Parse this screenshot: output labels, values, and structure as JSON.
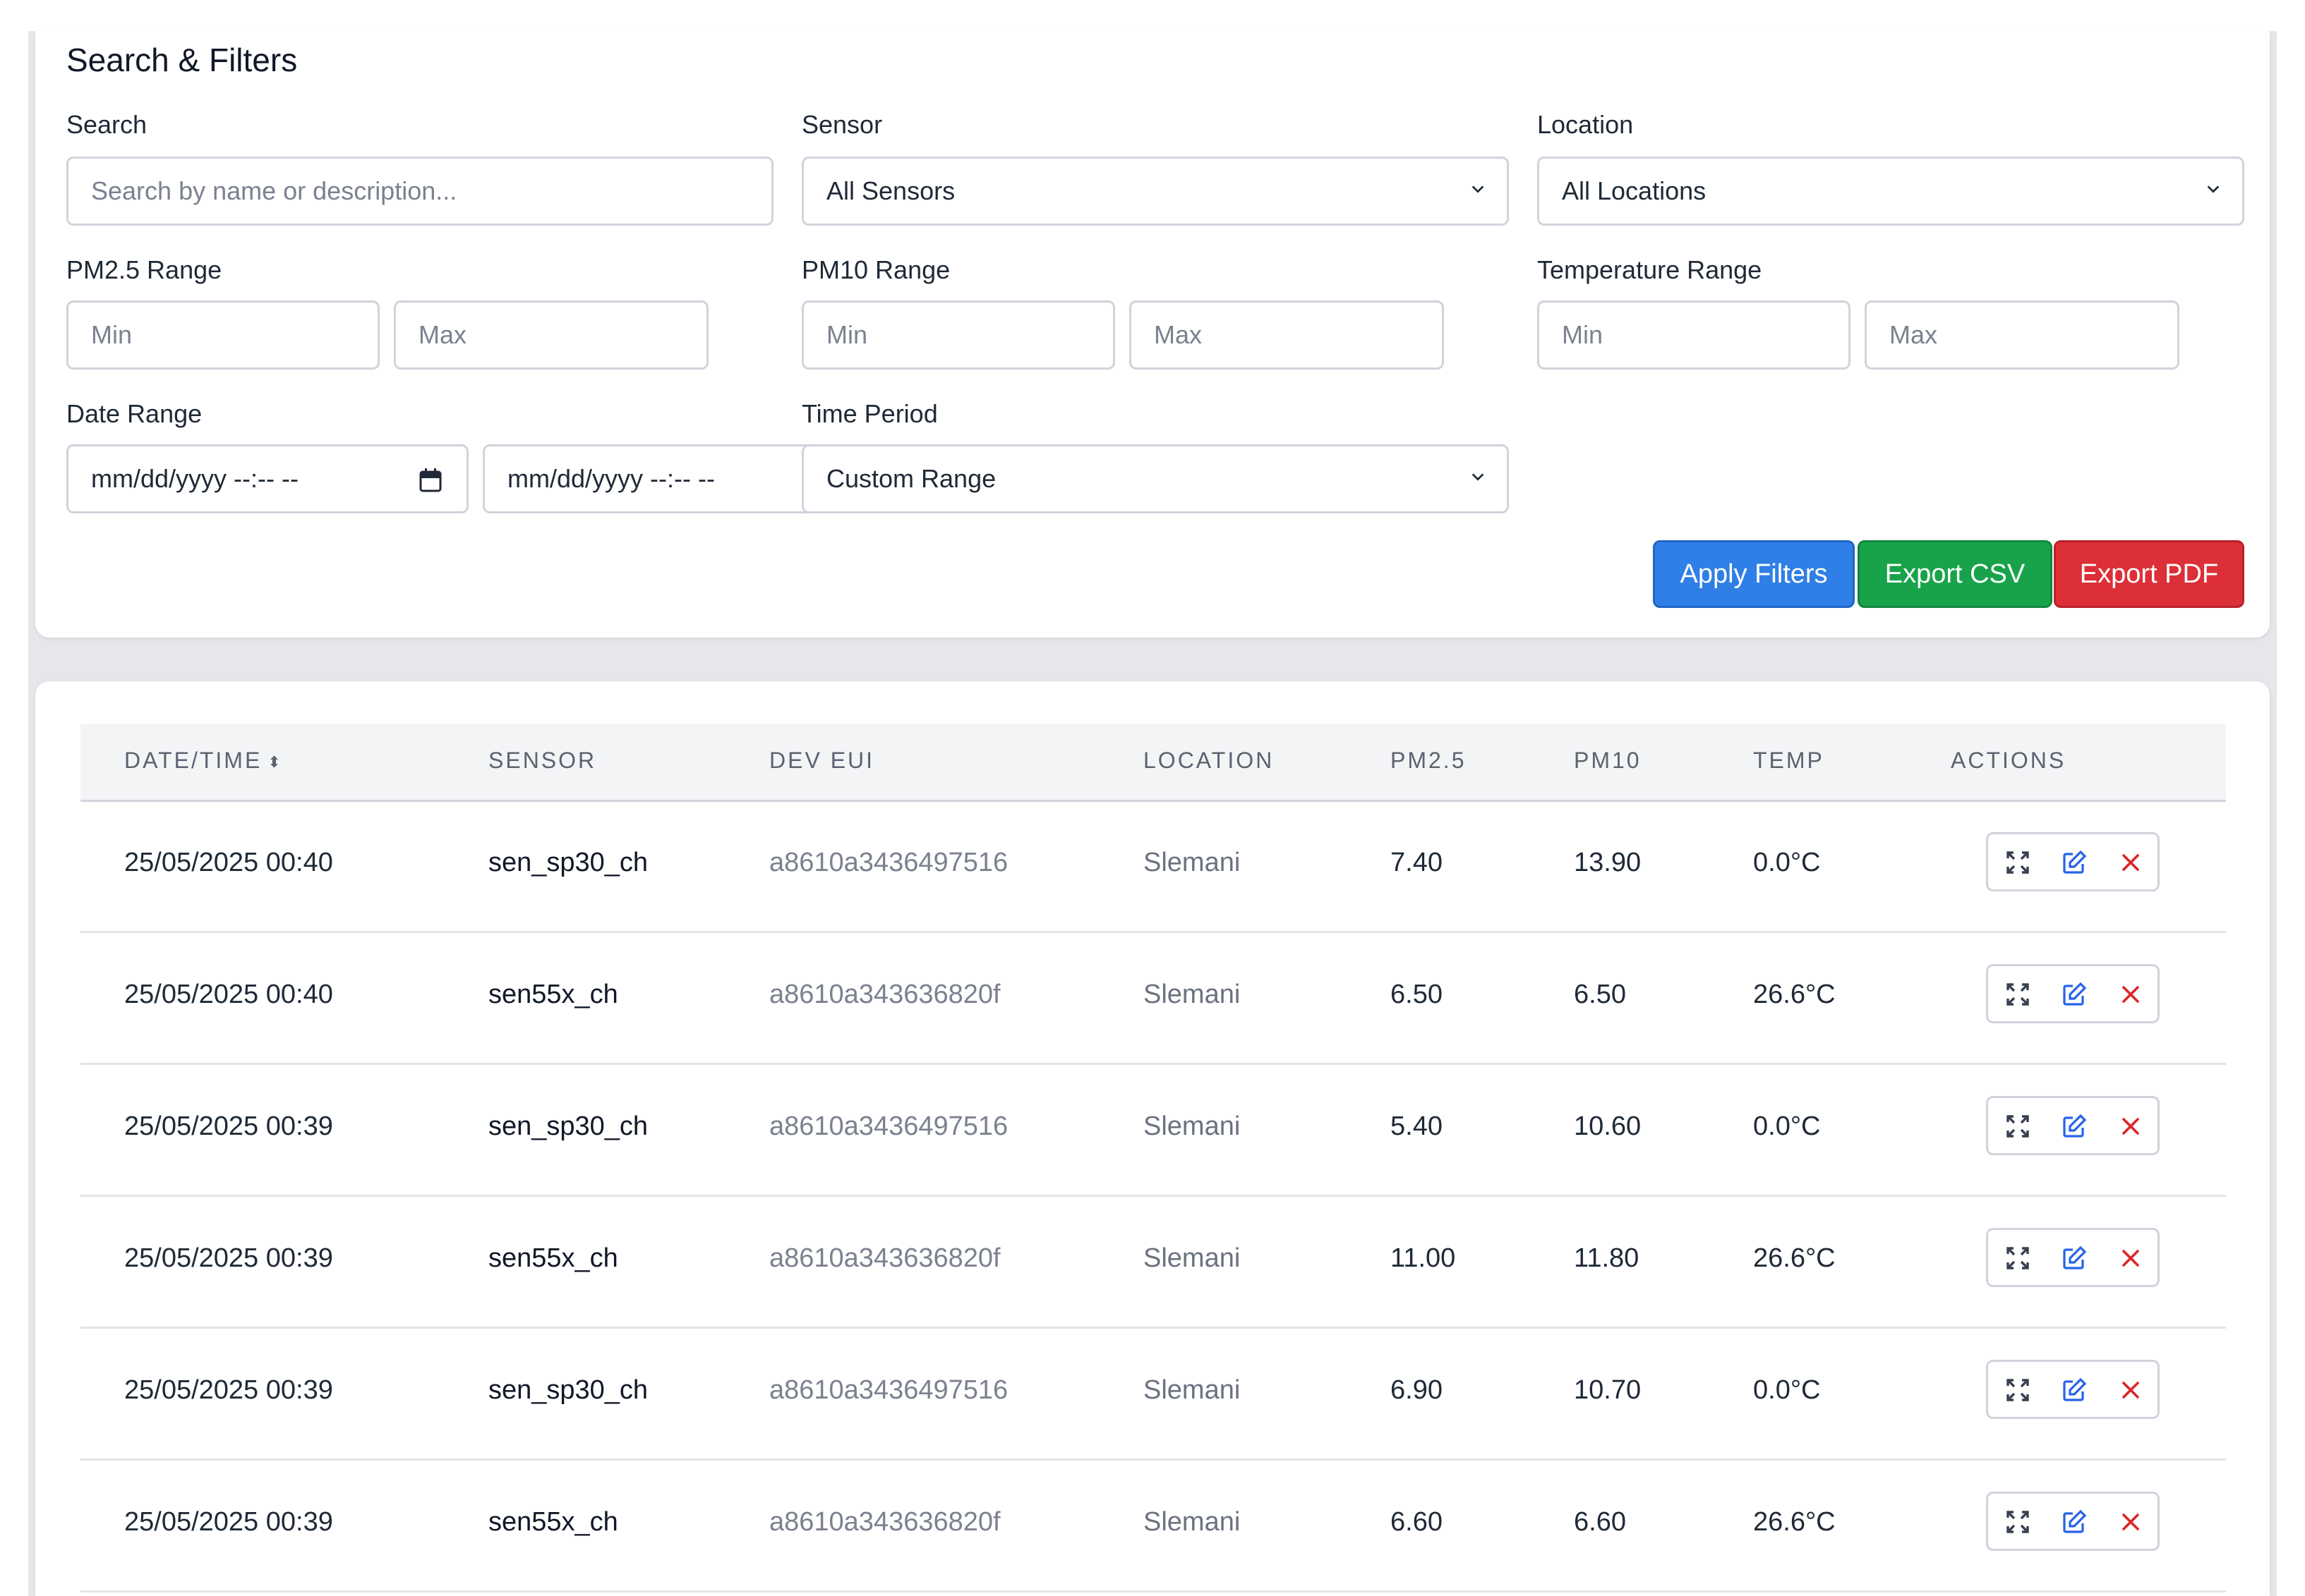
{
  "filters": {
    "title": "Search & Filters",
    "search": {
      "label": "Search",
      "placeholder": "Search by name or description..."
    },
    "sensor": {
      "label": "Sensor",
      "value": "All Sensors"
    },
    "location": {
      "label": "Location",
      "value": "All Locations"
    },
    "pm25": {
      "label": "PM2.5 Range",
      "min": "Min",
      "max": "Max"
    },
    "pm10": {
      "label": "PM10 Range",
      "min": "Min",
      "max": "Max"
    },
    "temp": {
      "label": "Temperature Range",
      "min": "Min",
      "max": "Max"
    },
    "date": {
      "label": "Date Range",
      "from": "mm/dd/yyyy --:-- --",
      "to": "mm/dd/yyyy --:-- --"
    },
    "period": {
      "label": "Time Period",
      "value": "Custom Range"
    },
    "buttons": {
      "apply": "Apply Filters",
      "csv": "Export CSV",
      "pdf": "Export PDF"
    }
  },
  "table": {
    "headers": {
      "datetime": "DATE/TIME",
      "sort_icon": "⬍",
      "sensor": "SENSOR",
      "dev_eui": "DEV EUI",
      "location": "LOCATION",
      "pm25": "PM2.5",
      "pm10": "PM10",
      "temp": "TEMP",
      "actions": "ACTIONS"
    },
    "rows": [
      {
        "datetime": "25/05/2025 00:40",
        "sensor": "sen_sp30_ch",
        "dev_eui": "a8610a3436497516",
        "location": "Slemani",
        "pm25": "7.40",
        "pm10": "13.90",
        "temp": "0.0°C"
      },
      {
        "datetime": "25/05/2025 00:40",
        "sensor": "sen55x_ch",
        "dev_eui": "a8610a343636820f",
        "location": "Slemani",
        "pm25": "6.50",
        "pm10": "6.50",
        "temp": "26.6°C"
      },
      {
        "datetime": "25/05/2025 00:39",
        "sensor": "sen_sp30_ch",
        "dev_eui": "a8610a3436497516",
        "location": "Slemani",
        "pm25": "5.40",
        "pm10": "10.60",
        "temp": "0.0°C"
      },
      {
        "datetime": "25/05/2025 00:39",
        "sensor": "sen55x_ch",
        "dev_eui": "a8610a343636820f",
        "location": "Slemani",
        "pm25": "11.00",
        "pm10": "11.80",
        "temp": "26.6°C"
      },
      {
        "datetime": "25/05/2025 00:39",
        "sensor": "sen_sp30_ch",
        "dev_eui": "a8610a3436497516",
        "location": "Slemani",
        "pm25": "6.90",
        "pm10": "10.70",
        "temp": "0.0°C"
      },
      {
        "datetime": "25/05/2025 00:39",
        "sensor": "sen55x_ch",
        "dev_eui": "a8610a343636820f",
        "location": "Slemani",
        "pm25": "6.60",
        "pm10": "6.60",
        "temp": "26.6°C"
      }
    ],
    "action_icons": [
      "expand-icon",
      "edit-icon",
      "delete-icon"
    ]
  },
  "colors": {
    "apply": "#2f7fe6",
    "csv": "#18a34a",
    "pdf": "#dc2f37",
    "edit_icon": "#2563eb",
    "delete_icon": "#dc2626"
  }
}
